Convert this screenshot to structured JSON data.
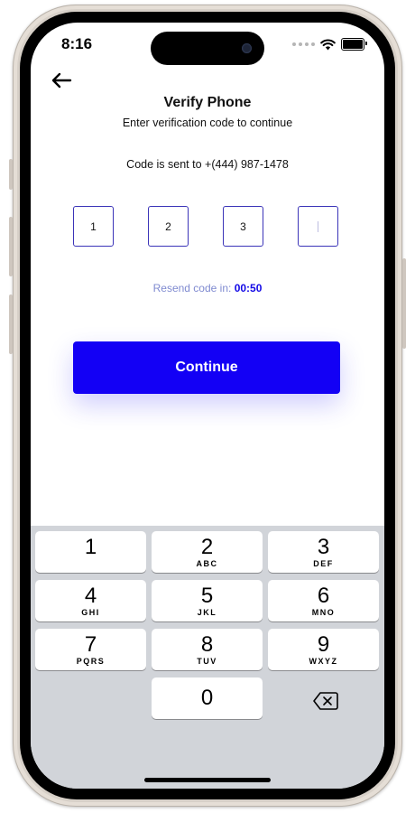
{
  "status_bar": {
    "time": "8:16"
  },
  "header": {
    "title": "Verify Phone",
    "subtitle": "Enter verification code to continue"
  },
  "sent_info": "Code is sent to +(444) 987-1478",
  "code_digits": [
    "1",
    "2",
    "3",
    ""
  ],
  "resend": {
    "label": "Resend code in:",
    "timer": "00:50"
  },
  "continue_label": "Continue",
  "keypad": {
    "keys": [
      {
        "digit": "1",
        "letters": ""
      },
      {
        "digit": "2",
        "letters": "ABC"
      },
      {
        "digit": "3",
        "letters": "DEF"
      },
      {
        "digit": "4",
        "letters": "GHI"
      },
      {
        "digit": "5",
        "letters": "JKL"
      },
      {
        "digit": "6",
        "letters": "MNO"
      },
      {
        "digit": "7",
        "letters": "PQRS"
      },
      {
        "digit": "8",
        "letters": "TUV"
      },
      {
        "digit": "9",
        "letters": "WXYZ"
      },
      {
        "digit": "0",
        "letters": ""
      }
    ]
  },
  "colors": {
    "accent": "#1300F5",
    "timer": "#1208E6",
    "resend_text": "#7F8AD0",
    "keypad_bg": "#D1D4D9"
  },
  "icons": {
    "back": "arrow-left-icon",
    "backspace": "backspace-icon",
    "wifi": "wifi-icon",
    "battery": "battery-icon"
  }
}
